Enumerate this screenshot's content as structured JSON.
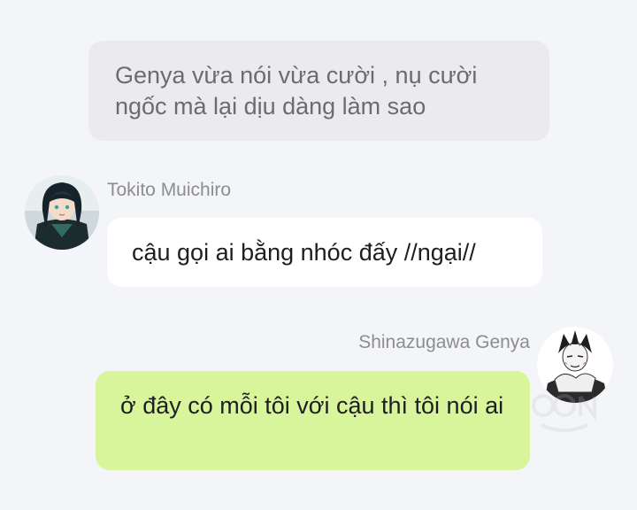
{
  "messages": {
    "narration": {
      "text": "Genya vừa nói vừa cười , nụ cười ngốc mà lại dịu dàng làm sao"
    },
    "left": {
      "sender": "Tokito Muichiro",
      "text": "cậu gọi ai bằng nhóc đấy //ngại//",
      "avatar": "tokito-avatar-icon"
    },
    "right": {
      "sender": "Shinazugawa Genya",
      "text": "ở đây có mỗi tôi với cậu thì tôi nói ai",
      "avatar": "genya-avatar-icon"
    }
  },
  "colors": {
    "background": "#f4f5f9",
    "narration_bubble": "#ebebed",
    "left_bubble": "#ffffff",
    "right_bubble": "#d9f59b",
    "sender_text": "#8c8c93"
  }
}
